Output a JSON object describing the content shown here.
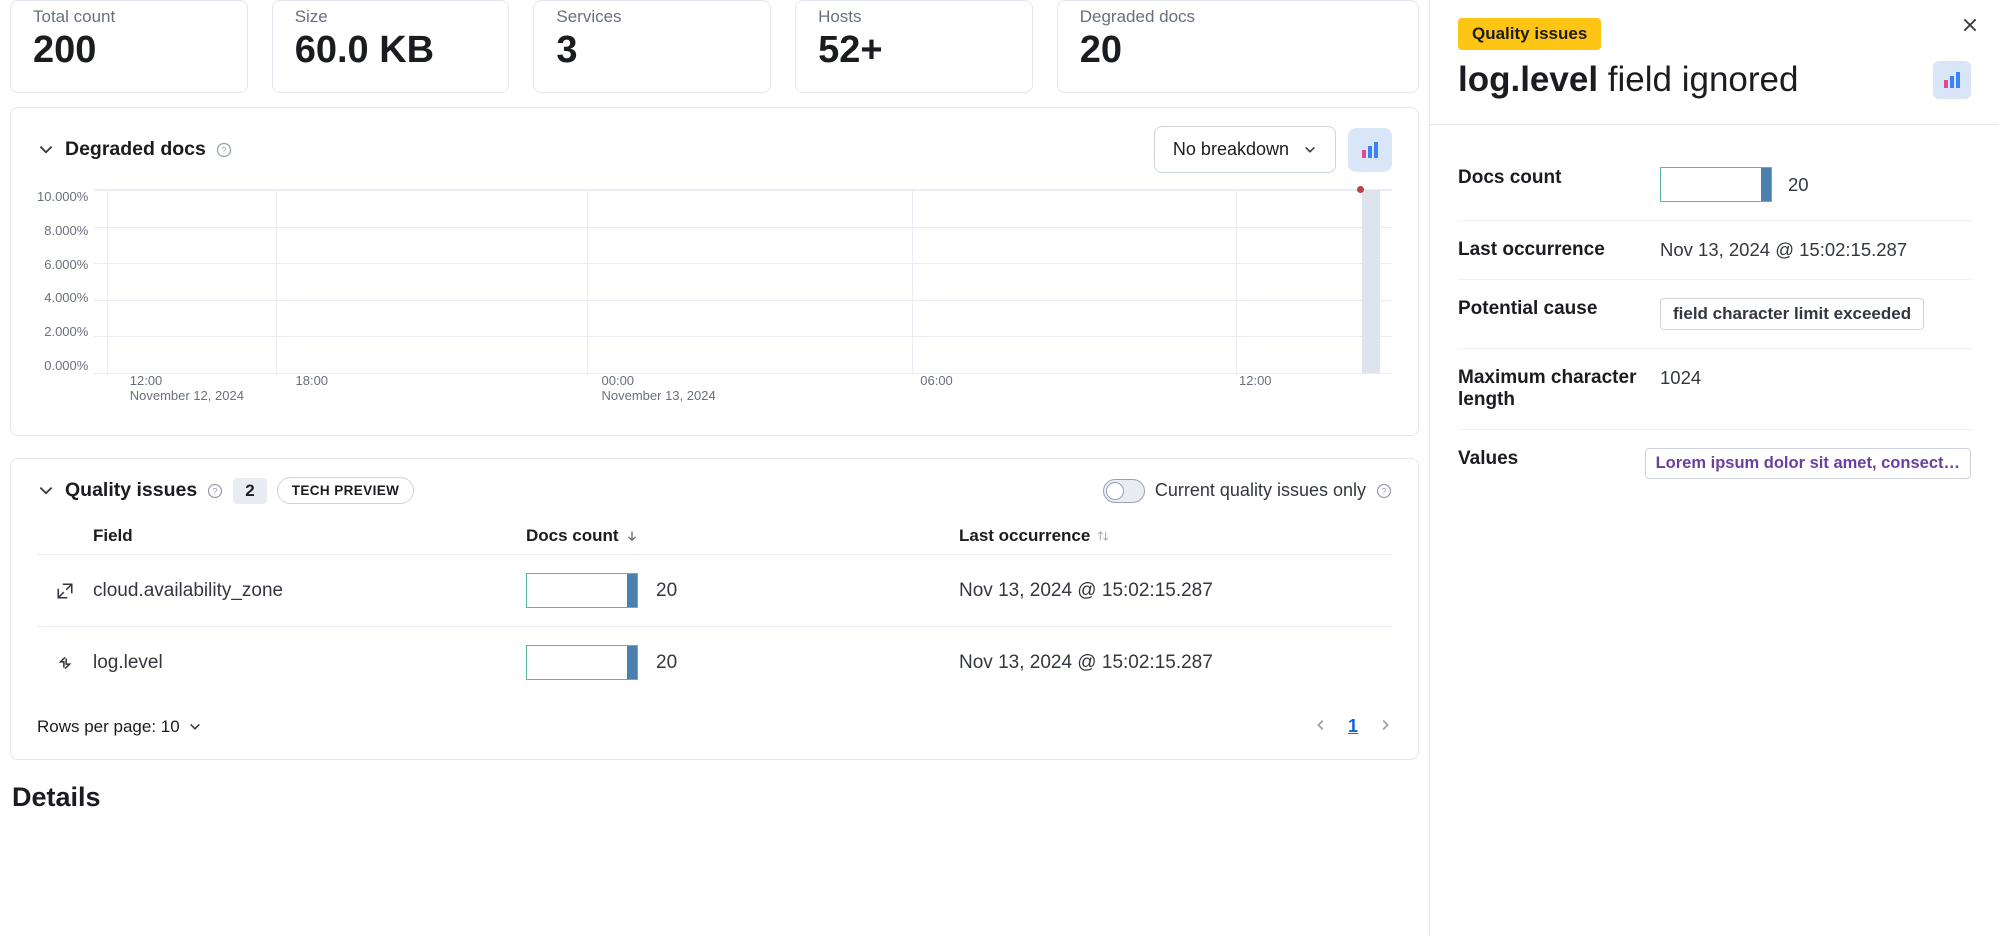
{
  "stats": {
    "total_count": {
      "label": "Total count",
      "value": "200"
    },
    "size": {
      "label": "Size",
      "value": "60.0 KB"
    },
    "services": {
      "label": "Services",
      "value": "3"
    },
    "hosts": {
      "label": "Hosts",
      "value": "52+"
    },
    "degraded": {
      "label": "Degraded docs",
      "value": "20"
    }
  },
  "degraded_panel": {
    "title": "Degraded docs",
    "breakdown_label": "No breakdown"
  },
  "chart_data": {
    "type": "line",
    "title": "Degraded docs",
    "ylabel": "",
    "xlabel": "",
    "ylim": [
      0,
      10
    ],
    "y_unit": "%",
    "y_ticks": [
      "10.000%",
      "8.000%",
      "6.000%",
      "4.000%",
      "2.000%",
      "0.000%"
    ],
    "x_ticks": [
      {
        "label": "12:00",
        "sub": "November 12, 2024",
        "pos": 0.01
      },
      {
        "label": "18:00",
        "sub": "",
        "pos": 0.14
      },
      {
        "label": "00:00",
        "sub": "November 13, 2024",
        "pos": 0.38
      },
      {
        "label": "06:00",
        "sub": "",
        "pos": 0.63
      },
      {
        "label": "12:00",
        "sub": "",
        "pos": 0.88
      }
    ],
    "series": [
      {
        "name": "degraded",
        "points": [
          {
            "x_pos": 0.975,
            "y": 10.0
          }
        ]
      }
    ]
  },
  "quality_issues": {
    "title": "Quality issues",
    "count": "2",
    "tech_badge": "TECH PREVIEW",
    "toggle_label": "Current quality issues only",
    "columns": {
      "field": "Field",
      "docs": "Docs count",
      "last": "Last occurrence"
    },
    "rows": [
      {
        "field": "cloud.availability_zone",
        "docs": "20",
        "last": "Nov 13, 2024 @ 15:02:15.287"
      },
      {
        "field": "log.level",
        "docs": "20",
        "last": "Nov 13, 2024 @ 15:02:15.287"
      }
    ],
    "rows_per_page_label": "Rows per page: 10",
    "page_current": "1"
  },
  "details_heading": "Details",
  "flyout": {
    "badge": "Quality issues",
    "title_field": "log.level",
    "title_suffix": "field ignored",
    "docs_count_label": "Docs count",
    "docs_count_value": "20",
    "last_occurrence_label": "Last occurrence",
    "last_occurrence_value": "Nov 13, 2024 @ 15:02:15.287",
    "potential_cause_label": "Potential cause",
    "potential_cause_value": "field character limit exceeded",
    "max_char_label": "Maximum character length",
    "max_char_value": "1024",
    "values_label": "Values",
    "values_value": "Lorem ipsum dolor sit amet, consect…"
  }
}
